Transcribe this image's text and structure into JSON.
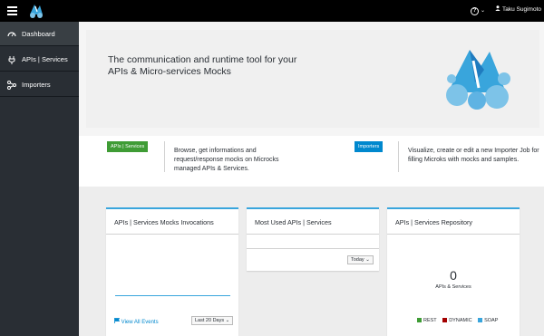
{
  "topbar": {
    "help_caret": "⌄",
    "user_name": "Taku Sugimoto",
    "user_caret": "⌄"
  },
  "sidebar": {
    "items": [
      {
        "label": "Dashboard",
        "icon": "dashboard-icon"
      },
      {
        "label": "APIs | Services",
        "icon": "plug-icon"
      },
      {
        "label": "Importers",
        "icon": "network-icon"
      }
    ]
  },
  "hero": {
    "text": "The communication and runtime tool for your APIs & Micro-services Mocks"
  },
  "tiles": {
    "apis": {
      "badge": "APIs | Services",
      "description": "Browse, get informations and request/response mocks on Microcks managed APIs & Services."
    },
    "importers": {
      "badge": "Importers",
      "description": "Visualize, create or edit a new Importer Job for filling Microks with mocks and samples."
    }
  },
  "cards": {
    "invocations": {
      "title": "APIs | Services Mocks Invocations",
      "link": "View All Events",
      "range": "Last 20 Days",
      "caret": "⌄"
    },
    "most_used": {
      "title": "Most Used APIs | Services",
      "range": "Today",
      "caret": "⌄"
    },
    "repository": {
      "title": "APIs | Services Repository",
      "count": "0",
      "count_label": "APIs & Services",
      "legend": [
        {
          "label": "REST",
          "color": "#3f9c35"
        },
        {
          "label": "DYNAMIC",
          "color": "#a30000"
        },
        {
          "label": "SOAP",
          "color": "#39a5dc"
        }
      ]
    }
  },
  "colors": {
    "accent": "#39a5dc",
    "sidebar": "#292e34",
    "green": "#3f9c35",
    "blue": "#0088ce"
  }
}
